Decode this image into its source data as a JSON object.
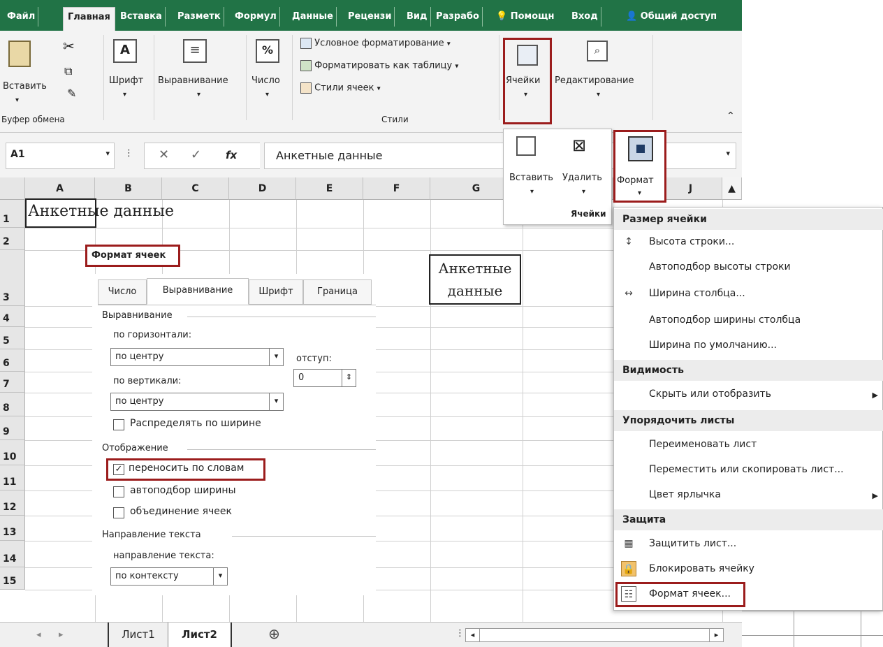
{
  "ribbon_tabs": [
    "Файл",
    "Главная",
    "Вставка",
    "Разметк",
    "Формул",
    "Данные",
    "Рецензи",
    "Вид",
    "Разрабо",
    "Помощн",
    "Вход",
    "Общий доступ"
  ],
  "clipboard": {
    "paste_label": "Вставить",
    "group_label": "Буфер обмена"
  },
  "font_label": "Шрифт",
  "align_label": "Выравнивание",
  "number_label": "Число",
  "styles": {
    "conditional": "Условное форматирование",
    "as_table": "Форматировать как таблицу",
    "cell_styles": "Стили ячеек",
    "group_label": "Стили"
  },
  "cells_label": "Ячейки",
  "editing_label": "Редактирование",
  "formula_bar": {
    "name_box": "A1",
    "fx": "fx",
    "content": "Анкетные данные"
  },
  "columns": [
    "A",
    "B",
    "C",
    "D",
    "E",
    "F",
    "G",
    "J"
  ],
  "rows": [
    "1",
    "2",
    "3",
    "4",
    "5",
    "6",
    "7",
    "8",
    "9",
    "10",
    "11",
    "12",
    "13",
    "14",
    "15"
  ],
  "cell_a1": "Анкетные данные",
  "cell_g3": "Анкетные данные",
  "cells_panel": {
    "insert": "Вставить",
    "delete": "Удалить",
    "format": "Формат",
    "group_label": "Ячейки"
  },
  "format_menu": {
    "size_header": "Размер ячейки",
    "row_height": "Высота строки...",
    "autofit_row": "Автоподбор высоты строки",
    "col_width": "Ширина столбца...",
    "autofit_col": "Автоподбор ширины столбца",
    "default_width": "Ширина по умолчанию...",
    "visibility_header": "Видимость",
    "hide_show": "Скрыть или отобразить",
    "organize_header": "Упорядочить листы",
    "rename": "Переименовать лист",
    "move_copy": "Переместить или скопировать лист...",
    "tab_color": "Цвет ярлычка",
    "protect_header": "Защита",
    "protect_sheet": "Защитить лист...",
    "lock_cell": "Блокировать ячейку",
    "format_cells": "Формат ячеек..."
  },
  "dialog": {
    "title": "Формат ячеек",
    "tabs": [
      "Число",
      "Выравнивание",
      "Шрифт",
      "Граница"
    ],
    "align_group": "Выравнивание",
    "horiz_label": "по горизонтали:",
    "horiz_value": "по центру",
    "indent_label": "отступ:",
    "indent_value": "0",
    "vert_label": "по вертикали:",
    "vert_value": "по центру",
    "distribute": "Распределять по ширине",
    "display_group": "Отображение",
    "wrap": "переносить по словам",
    "shrink": "автоподбор ширины",
    "merge": "объединение ячеек",
    "dir_group": "Направление текста",
    "dir_label": "направление текста:",
    "dir_value": "по контексту"
  },
  "sheet_tabs": [
    "Лист1",
    "Лист2"
  ],
  "colors": {
    "excel_green": "#217346",
    "highlight_red": "#9b1c1c"
  }
}
